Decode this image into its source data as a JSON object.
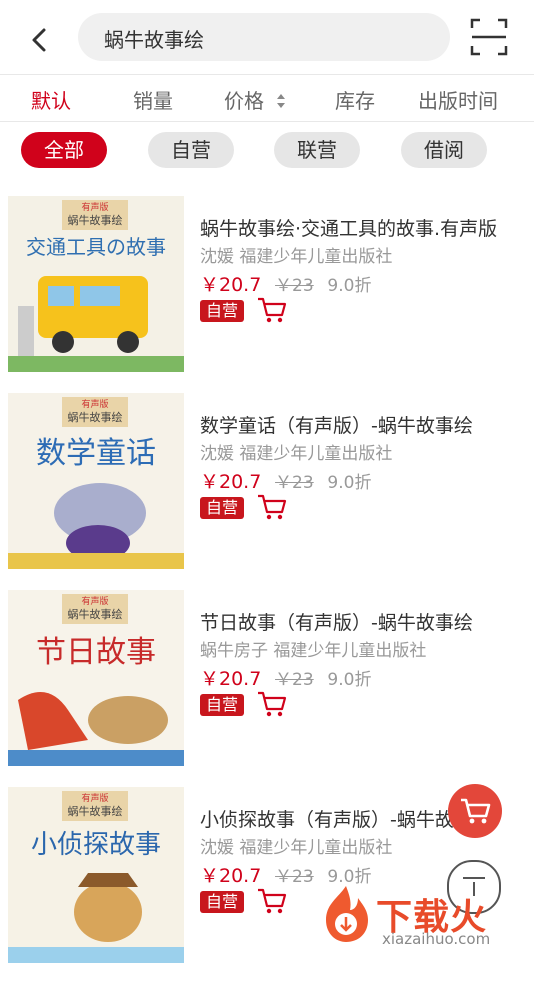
{
  "search": {
    "query": "蜗牛故事绘"
  },
  "sort": {
    "default": "默认",
    "sales": "销量",
    "price": "价格",
    "stock": "库存",
    "pub_time": "出版时间"
  },
  "filters": [
    "全部",
    "自营",
    "联营",
    "借阅"
  ],
  "products": [
    {
      "title": "蜗牛故事绘·交通工具的故事.有声版",
      "author": "沈媛",
      "publisher": "福建少年儿童出版社",
      "price": "￥20.7",
      "old_price": "￥23",
      "discount": "9.0折",
      "tag": "自营",
      "cover": {
        "badge": "有声版",
        "series": "蜗牛故事绘",
        "title": "交通工具の故事",
        "bg": "#f4f1e6",
        "accent": "#2f6fb1"
      }
    },
    {
      "title": "数学童话（有声版）-蜗牛故事绘",
      "author": "沈媛",
      "publisher": "福建少年儿童出版社",
      "price": "￥20.7",
      "old_price": "￥23",
      "discount": "9.0折",
      "tag": "自营",
      "cover": {
        "badge": "有声版",
        "series": "蜗牛故事绘",
        "title": "数学童话",
        "bg": "#f6f2e8",
        "accent": "#2d6cb5"
      }
    },
    {
      "title": "节日故事（有声版）-蜗牛故事绘",
      "author": "蜗牛房子",
      "publisher": "福建少年儿童出版社",
      "price": "￥20.7",
      "old_price": "￥23",
      "discount": "9.0折",
      "tag": "自营",
      "cover": {
        "badge": "有声版",
        "series": "蜗牛故事绘",
        "title": "节日故事",
        "bg": "#f7f3ea",
        "accent": "#c72a2a"
      }
    },
    {
      "title": "小侦探故事（有声版）-蜗牛故事绘",
      "author": "沈媛",
      "publisher": "福建少年儿童出版社",
      "price": "￥20.7",
      "old_price": "￥23",
      "discount": "9.0折",
      "tag": "自营",
      "cover": {
        "badge": "有声版",
        "series": "蜗牛故事绘",
        "title": "小侦探故事",
        "bg": "#f6f2e6",
        "accent": "#2b67ad"
      }
    }
  ],
  "watermark": {
    "text": "下载火",
    "sub": "xiazaihuo.com"
  },
  "colors": {
    "accent": "#d0021b",
    "chip_bg": "#e6e6e6",
    "fab": "#e3473a"
  },
  "icons": [
    "back-icon",
    "scan-icon",
    "sort-arrows-icon",
    "cart-icon",
    "fab-cart-icon",
    "back-to-top-icon"
  ]
}
